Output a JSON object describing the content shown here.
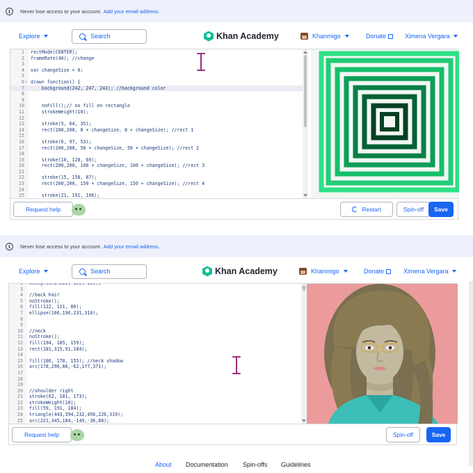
{
  "banner": {
    "text": "Never lose access to your account.",
    "link": "Add your email address."
  },
  "nav": {
    "explore": "Explore",
    "search": "Search",
    "logo": "Khan Academy",
    "khanmigo": "Khanmigo",
    "donate": "Donate",
    "user": "Ximena Vergara"
  },
  "editor1": {
    "lines": [
      {
        "n": "1",
        "code": "rectMode(CENTER);"
      },
      {
        "n": "2",
        "code": "frameRate(40); //change"
      },
      {
        "n": "3",
        "code": ""
      },
      {
        "n": "4",
        "code": "var changeSize = 0;"
      },
      {
        "n": "5",
        "code": ""
      },
      {
        "n": "6",
        "code": "draw= function() {",
        "fold": true
      },
      {
        "n": "7",
        "code": "    background(242, 247, 243); //background color",
        "active": true
      },
      {
        "n": "8",
        "code": ""
      },
      {
        "n": "9",
        "code": ""
      },
      {
        "n": "10",
        "code": "    noFill();// no fill on rectangle"
      },
      {
        "n": "11",
        "code": "    strokeWeight(10);"
      },
      {
        "n": "12",
        "code": ""
      },
      {
        "n": "13",
        "code": "    stroke(5, 64, 35);"
      },
      {
        "n": "14",
        "code": "    rect(200,200, 0 + changeSize, 0 + changeSize); //rect 1"
      },
      {
        "n": "15",
        "code": ""
      },
      {
        "n": "16",
        "code": "    stroke(6, 97, 53);"
      },
      {
        "n": "17",
        "code": "    rect(200,200, 50 + changeSize, 50 + changeSize); //rect 2"
      },
      {
        "n": "18",
        "code": ""
      },
      {
        "n": "19",
        "code": "    stroke(10, 128, 69);"
      },
      {
        "n": "20",
        "code": "    rect(200,200, 100 + changeSize, 100 + changeSize); //rect 3"
      },
      {
        "n": "21",
        "code": ""
      },
      {
        "n": "22",
        "code": "    stroke(15, 158, 87);"
      },
      {
        "n": "23",
        "code": "    rect(200,200, 150 + changeSize, 150 + changeSize); //rect 4"
      },
      {
        "n": "24",
        "code": ""
      },
      {
        "n": "25",
        "code": "    stroke(21, 191, 106);"
      }
    ]
  },
  "editor2": {
    "lines": [
      {
        "n": "2",
        "code": "background(235, 155, 155);"
      },
      {
        "n": "3",
        "code": ""
      },
      {
        "n": "4",
        "code": "//back hair"
      },
      {
        "n": "5",
        "code": "noStroke();"
      },
      {
        "n": "6",
        "code": "fill(122, 111, 80);"
      },
      {
        "n": "7",
        "code": "ellipse(166,196,231,310);"
      },
      {
        "n": "8",
        "code": ""
      },
      {
        "n": "9",
        "code": ""
      },
      {
        "n": "10",
        "code": "//neck"
      },
      {
        "n": "11",
        "code": "noStroke();"
      },
      {
        "n": "12",
        "code": "fill(194, 185, 159);"
      },
      {
        "n": "13",
        "code": "rect(181,315,91,184);"
      },
      {
        "n": "14",
        "code": ""
      },
      {
        "n": "15",
        "code": "fill(186, 178, 155); //neck shadow"
      },
      {
        "n": "16",
        "code": "arc(178,296,86,-62,177,371);"
      },
      {
        "n": "17",
        "code": ""
      },
      {
        "n": "18",
        "code": ""
      },
      {
        "n": "19",
        "code": ""
      },
      {
        "n": "20",
        "code": "//shoulder right"
      },
      {
        "n": "21",
        "code": "stroke(62, 181, 173);"
      },
      {
        "n": "22",
        "code": "strokeWeight(10);"
      },
      {
        "n": "23",
        "code": "fill(59, 191, 184);"
      },
      {
        "n": "24",
        "code": "triangle(443,394,232,456,226,319);"
      },
      {
        "n": "25",
        "code": "arc(221,345,184,-149,-36,88);"
      }
    ]
  },
  "buttons": {
    "request_help": "Request help",
    "restart": "Restart",
    "spinoff": "Spin-off",
    "save": "Save"
  },
  "footer": {
    "about": "About",
    "documentation": "Documentation",
    "spinoffs": "Spin-offs",
    "guidelines": "Guidelines"
  },
  "colors": {
    "accent": "#1865f2",
    "cursor": "#9c2c7c",
    "squares": [
      "#05402300",
      "#054023",
      "#066135",
      "#0a8045",
      "#0f9e57",
      "#15bf6a",
      "#1fe07d"
    ],
    "portrait_bg": "#eb9b9b"
  },
  "icons": [
    "info-icon",
    "search-icon",
    "khan-logo-icon",
    "khanmigo-avatar-icon",
    "external-link-icon",
    "restart-icon",
    "khanmigo-blob-icon",
    "text-cursor-icon"
  ]
}
